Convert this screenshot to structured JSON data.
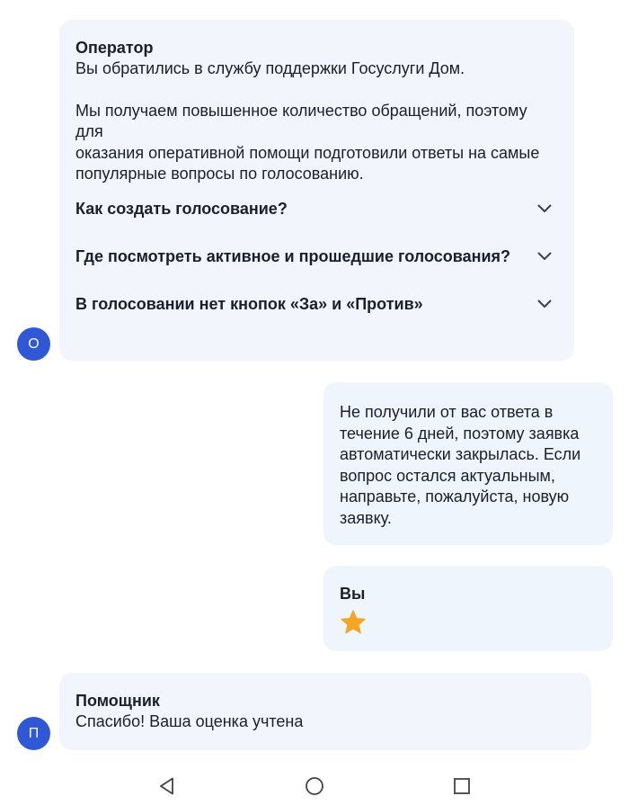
{
  "operator_message": {
    "sender": "Оператор",
    "intro": "Вы обратились в службу поддержки Госуслуги Дом.",
    "body_lines": [
      "Мы получаем повышенное количество обращений, поэтому для",
      "оказания оперативной помощи подготовили ответы на самые",
      "популярные вопросы по голосованию."
    ],
    "faq": [
      {
        "question": "Как создать голосование?"
      },
      {
        "question": "Где посмотреть активное и прошедшие голосования?"
      },
      {
        "question": "В голосовании нет кнопок «За» и «Против»"
      }
    ],
    "avatar_letter": "О"
  },
  "system_message": {
    "lines": [
      "Не получили от вас ответа в",
      "течение 6 дней, поэтому заявка",
      "автоматически закрылась. Если",
      "вопрос остался актуальным,",
      "направьте, пожалуйста, новую",
      "заявку."
    ]
  },
  "user_rating": {
    "sender": "Вы",
    "rating_stars": 1,
    "star_color": "#f5a623"
  },
  "assistant_message": {
    "sender": "Помощник",
    "text": "Спасибо! Ваша оценка учтена",
    "avatar_letter": "П"
  },
  "colors": {
    "avatar": "#2f57d6",
    "operator_bubble": "#f3f5fc",
    "user_bubble": "#eef5fc",
    "text": "#1a1f2c"
  },
  "navbar": {
    "icons": [
      "back-icon",
      "home-icon",
      "recents-icon"
    ]
  }
}
